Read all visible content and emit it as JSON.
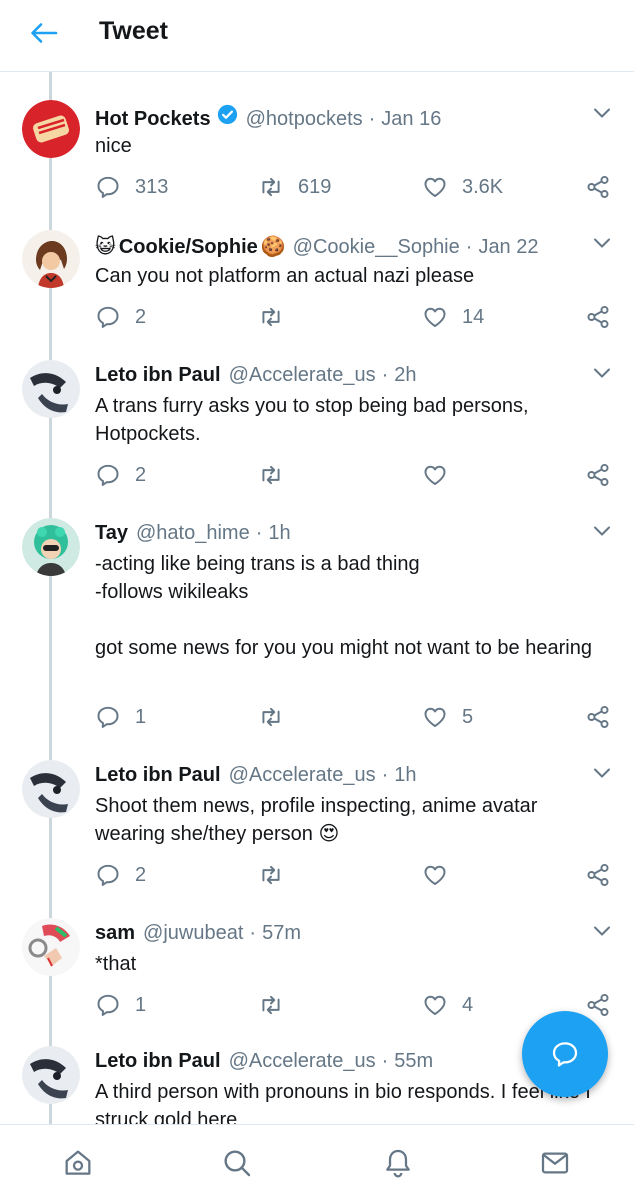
{
  "header": {
    "title": "Tweet",
    "back_icon": "back-arrow-icon"
  },
  "colors": {
    "accent": "#1da1f2",
    "secondary_text": "#657786",
    "divider": "#e1e8ed",
    "thread_line": "#ccd6dd"
  },
  "tweets": [
    {
      "name": "Hot Pockets",
      "verified": true,
      "handle": "@hotpockets",
      "time": "Jan 16",
      "text": "nice",
      "replies": "313",
      "retweets": "619",
      "likes": "3.6K"
    },
    {
      "name": "Cookie/Sophie",
      "name_prefix_emoji": "😺",
      "name_suffix_emoji": "🍪",
      "handle": "@Cookie__Sophie",
      "time": "Jan 22",
      "text": "Can you not platform an actual nazi please",
      "replies": "2",
      "retweets": "",
      "likes": "14"
    },
    {
      "name": "Leto ibn Paul",
      "handle": "@Accelerate_us",
      "time": "2h",
      "text": "A trans furry asks you to stop being bad persons, Hotpockets.",
      "replies": "2",
      "retweets": "",
      "likes": ""
    },
    {
      "name": "Tay",
      "handle": "@hato_hime",
      "time": "1h",
      "text": "-acting like being trans is a bad thing\n-follows wikileaks\n\ngot some news for you you might not want to be hearing",
      "replies": "1",
      "retweets": "",
      "likes": "5"
    },
    {
      "name": "Leto ibn Paul",
      "handle": "@Accelerate_us",
      "time": "1h",
      "text": "Shoot them news, profile inspecting, anime avatar wearing she/they person",
      "text_emoji": "😍",
      "replies": "2",
      "retweets": "",
      "likes": ""
    },
    {
      "name": "sam",
      "handle": "@juwubeat",
      "time": "57m",
      "text": "*that",
      "replies": "1",
      "retweets": "",
      "likes": "4"
    },
    {
      "name": "Leto ibn Paul",
      "handle": "@Accelerate_us",
      "time": "55m",
      "text": "A third person with pronouns in bio responds. I feel like I struck gold here"
    }
  ],
  "fab": {
    "icon": "compose-reply-icon"
  },
  "bottom_nav": [
    {
      "icon": "home-icon"
    },
    {
      "icon": "search-icon"
    },
    {
      "icon": "notifications-icon"
    },
    {
      "icon": "messages-icon"
    }
  ]
}
